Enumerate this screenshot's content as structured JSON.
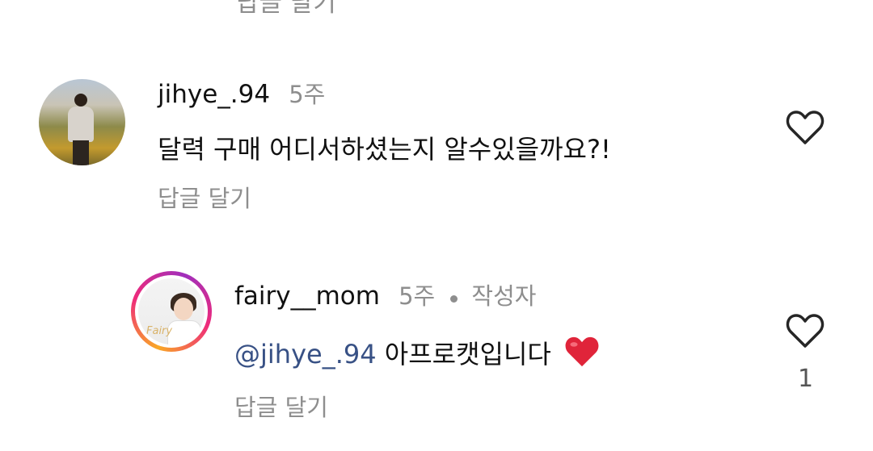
{
  "top_partial": {
    "reply_label": "답글 달기"
  },
  "comments": [
    {
      "username": "jihye_.94",
      "time": "5주",
      "text": "달력 구매 어디서하셨는지 알수있을까요?!",
      "reply_label": "답글 달기"
    },
    {
      "username": "fairy__mom",
      "time": "5주",
      "author_badge": "작성자",
      "mention": "@jihye_.94",
      "text": "아프로캣입니다",
      "emoji": "heart",
      "reply_label": "답글 달기",
      "like_count": "1",
      "avatar_logo": "Fairy"
    }
  ],
  "colors": {
    "mention": "#385185",
    "muted": "#8e8e8e",
    "story_ring": [
      "#f9a826",
      "#ee2a7b",
      "#a02fbc"
    ],
    "heart": "#e0243a"
  },
  "icons": [
    "heart-outline-icon",
    "red-heart-emoji"
  ]
}
